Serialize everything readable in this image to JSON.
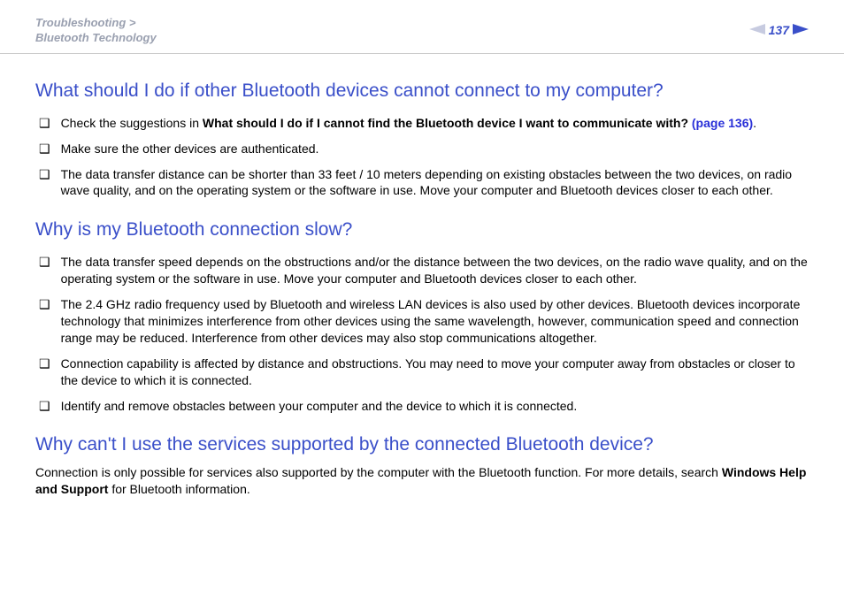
{
  "header": {
    "breadcrumb_line1": "Troubleshooting >",
    "breadcrumb_line2": "Bluetooth Technology",
    "page_number": "137"
  },
  "sections": [
    {
      "heading": "What should I do if other Bluetooth devices cannot connect to my computer?",
      "items": [
        {
          "pre": "Check the suggestions in ",
          "bold": "What should I do if I cannot find the Bluetooth device I want to communicate with? ",
          "link": "(page 136)",
          "post": "."
        },
        {
          "pre": "Make sure the other devices are authenticated."
        },
        {
          "pre": "The data transfer distance can be shorter than 33 feet / 10 meters depending on existing obstacles between the two devices, on radio wave quality, and on the operating system or the software in use. Move your computer and Bluetooth devices closer to each other."
        }
      ]
    },
    {
      "heading": "Why is my Bluetooth connection slow?",
      "items": [
        {
          "pre": "The data transfer speed depends on the obstructions and/or the distance between the two devices, on the radio wave quality, and on the operating system or the software in use. Move your computer and Bluetooth devices closer to each other."
        },
        {
          "pre": "The 2.4 GHz radio frequency used by Bluetooth and wireless LAN devices is also used by other devices. Bluetooth devices incorporate technology that minimizes interference from other devices using the same wavelength, however, communication speed and connection range may be reduced. Interference from other devices may also stop communications altogether."
        },
        {
          "pre": "Connection capability is affected by distance and obstructions. You may need to move your computer away from obstacles or closer to the device to which it is connected."
        },
        {
          "pre": "Identify and remove obstacles between your computer and the device to which it is connected."
        }
      ]
    },
    {
      "heading": "Why can't I use the services supported by the connected Bluetooth device?",
      "paragraph_pre": "Connection is only possible for services also supported by the computer with the Bluetooth function. For more details, search ",
      "paragraph_bold": "Windows Help and Support",
      "paragraph_post": " for Bluetooth information."
    }
  ]
}
